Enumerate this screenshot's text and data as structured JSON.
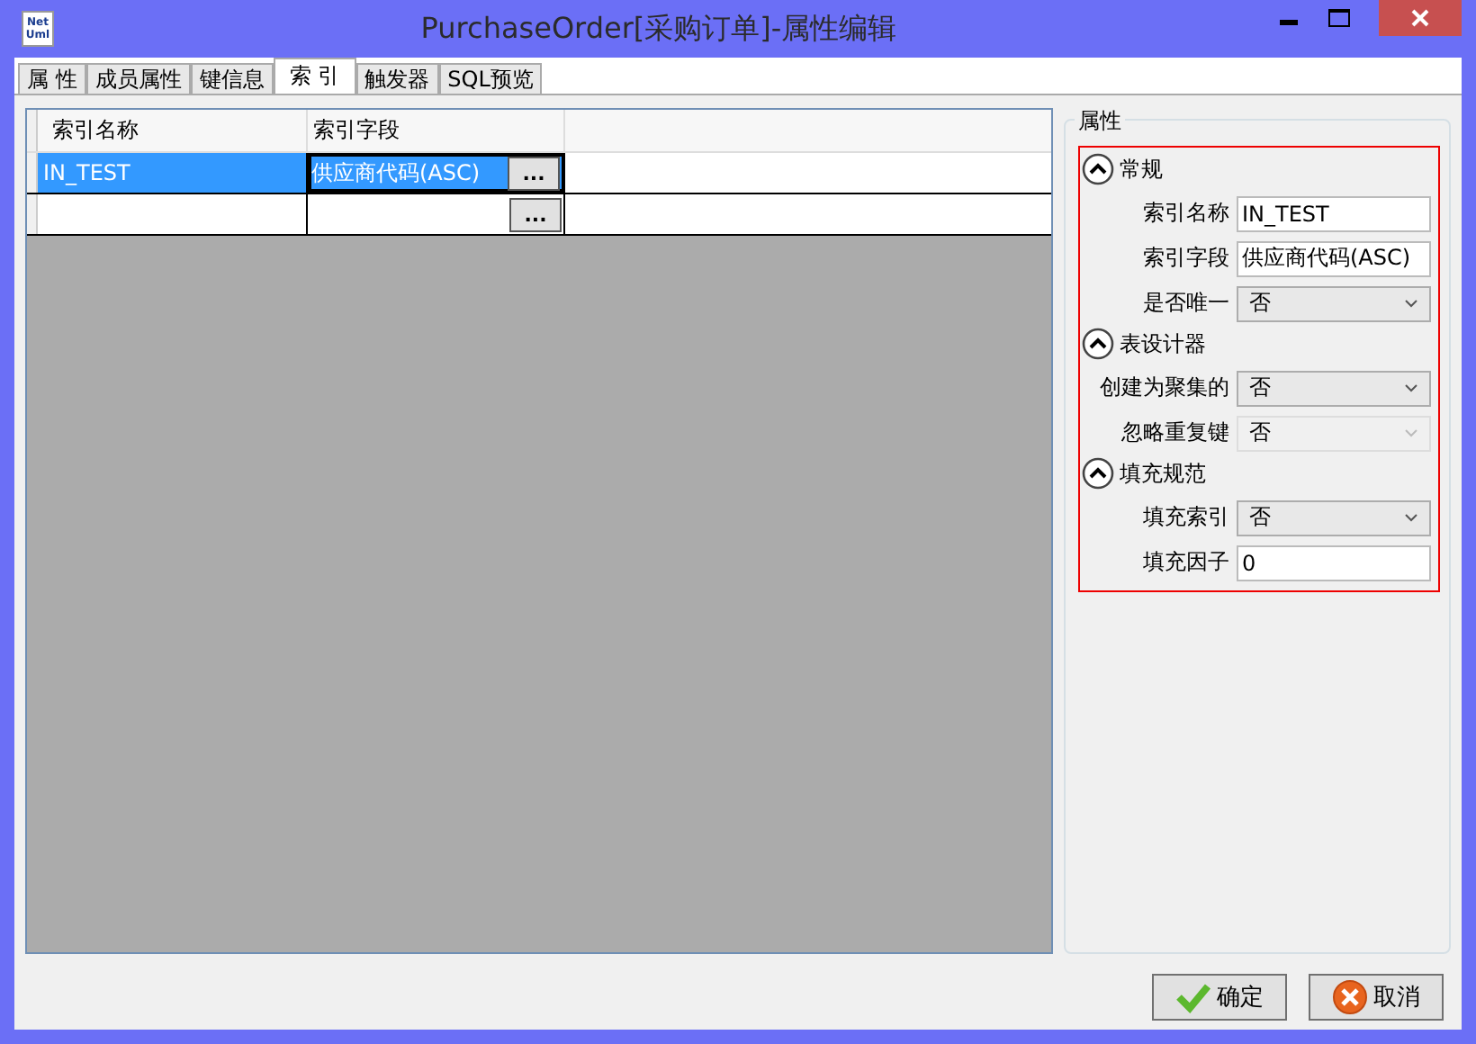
{
  "window": {
    "title": "PurchaseOrder[采购订单]-属性编辑",
    "app_icon": [
      "Net",
      "Uml"
    ]
  },
  "tabs": [
    {
      "label": "属 性",
      "selected": false
    },
    {
      "label": "成员属性",
      "selected": false
    },
    {
      "label": "键信息",
      "selected": false
    },
    {
      "label": "索 引",
      "selected": true
    },
    {
      "label": "触发器",
      "selected": false
    },
    {
      "label": "SQL预览",
      "selected": false
    }
  ],
  "index_table": {
    "columns": [
      "索引名称",
      "索引字段"
    ],
    "rows": [
      {
        "name": "IN_TEST",
        "field": "供应商代码(ASC)",
        "browse_label": "...",
        "selected": true
      },
      {
        "browse_label": "...",
        "selected": false
      }
    ]
  },
  "properties": {
    "title": "属性",
    "categories": [
      {
        "label": "常规",
        "expanded": true,
        "items": [
          {
            "kind": "text",
            "label": "索引名称",
            "value": "IN_TEST",
            "disabled": false
          },
          {
            "kind": "text",
            "label": "索引字段",
            "value": "供应商代码(ASC)",
            "disabled": false
          },
          {
            "kind": "select",
            "label": "是否唯一",
            "value": "否",
            "disabled": false
          }
        ]
      },
      {
        "label": "表设计器",
        "expanded": true,
        "items": [
          {
            "kind": "select",
            "label": "创建为聚集的",
            "value": "否",
            "disabled": false
          },
          {
            "kind": "select",
            "label": "忽略重复键",
            "value": "否",
            "disabled": true
          }
        ]
      },
      {
        "label": "填充规范",
        "expanded": true,
        "items": [
          {
            "kind": "select",
            "label": "填充索引",
            "value": "否",
            "disabled": false
          },
          {
            "kind": "text",
            "label": "填充因子",
            "value": "0",
            "disabled": false
          }
        ]
      }
    ]
  },
  "buttons": [
    {
      "kind": "ok",
      "label": "确定"
    },
    {
      "kind": "cancel",
      "label": "取消"
    }
  ]
}
